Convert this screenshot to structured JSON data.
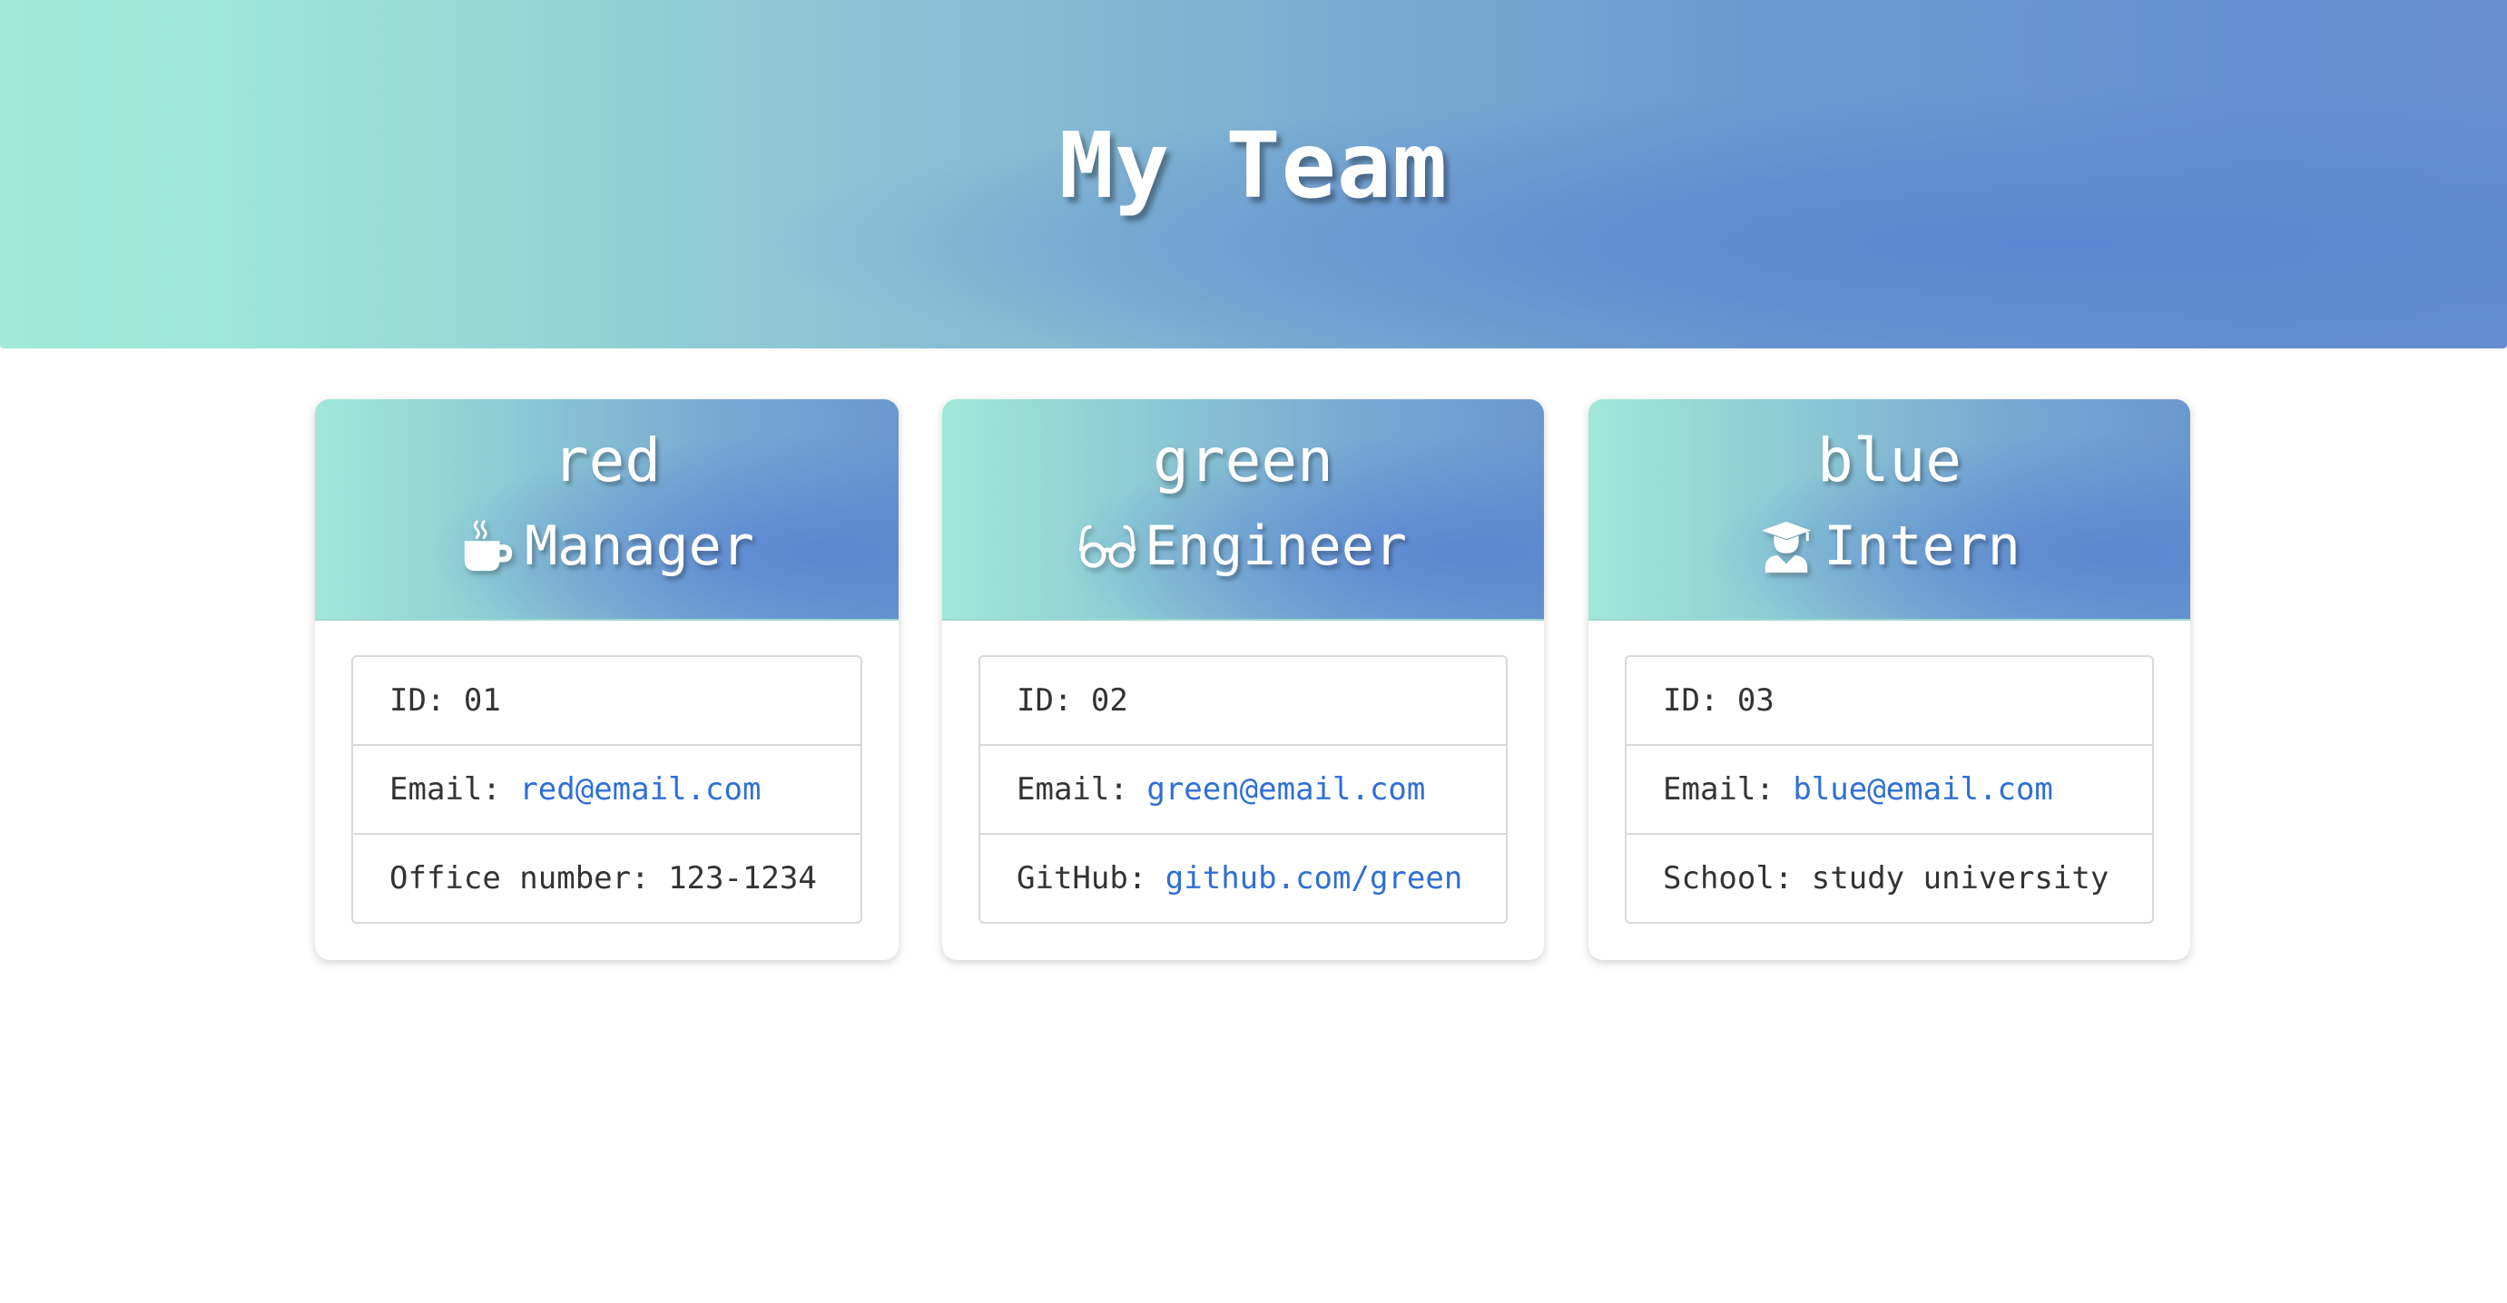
{
  "header": {
    "title": "My Team"
  },
  "cards": [
    {
      "name": "red",
      "role": "Manager",
      "role_icon": "coffee-mug-icon",
      "id_label": "ID:",
      "id_value": "01",
      "email_label": "Email:",
      "email_value": "red@email.com",
      "extra_label": "Office number:",
      "extra_value": "123-1234",
      "extra_is_link": false
    },
    {
      "name": "green",
      "role": "Engineer",
      "role_icon": "glasses-icon",
      "id_label": "ID:",
      "id_value": "02",
      "email_label": "Email:",
      "email_value": "green@email.com",
      "extra_label": "GitHub:",
      "extra_value": "github.com/green",
      "extra_is_link": true
    },
    {
      "name": "blue",
      "role": "Intern",
      "role_icon": "graduate-icon",
      "id_label": "ID:",
      "id_value": "03",
      "email_label": "Email:",
      "email_value": "blue@email.com",
      "extra_label": "School:",
      "extra_value": "study university",
      "extra_is_link": false
    }
  ],
  "colors": {
    "accent_start": "#a2e9d9",
    "accent_end": "#5b86d1",
    "link": "#2f6fd6",
    "text": "#333333"
  }
}
